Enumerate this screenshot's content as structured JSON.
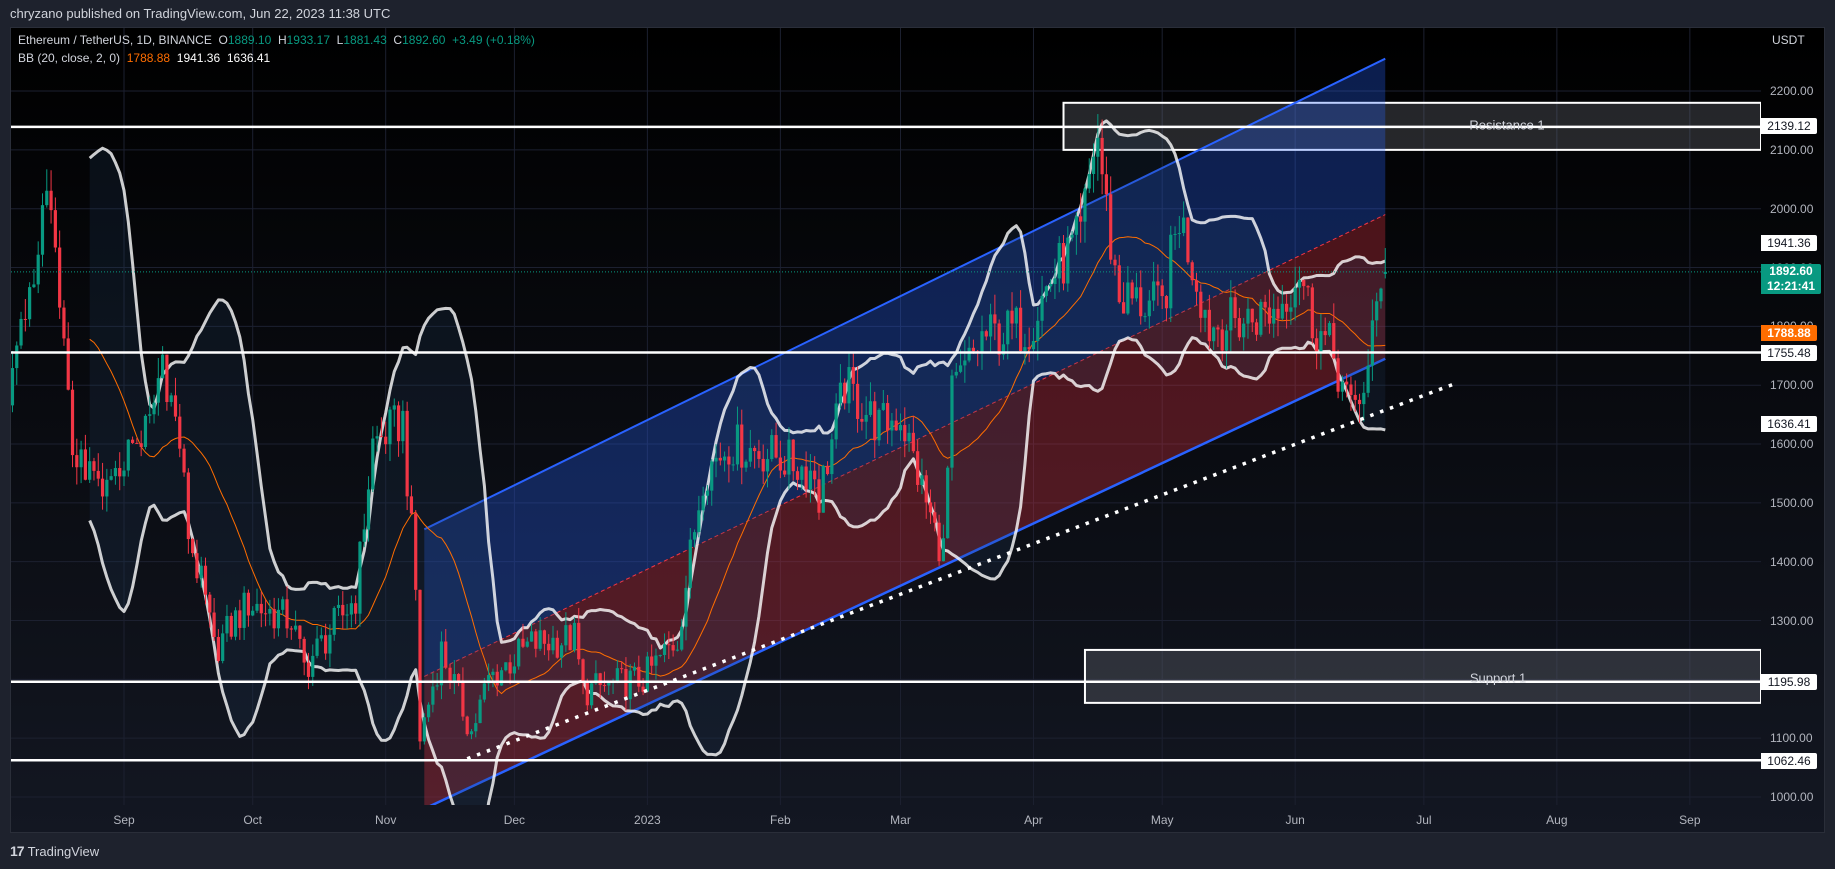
{
  "header": {
    "published": "chryzano published on TradingView.com, Jun 22, 2023 11:38 UTC"
  },
  "legend": {
    "symbol": "Ethereum / TetherUS, 1D, BINANCE",
    "o_label": "O",
    "o": "1889.10",
    "h_label": "H",
    "h": "1933.17",
    "l_label": "L",
    "l": "1881.43",
    "c_label": "C",
    "c": "1892.60",
    "change": "+3.49 (+0.18%)",
    "bb_label": "BB (20, close, 2, 0)",
    "bb_basis": "1788.88",
    "bb_upper": "1941.36",
    "bb_lower": "1636.41"
  },
  "axis": {
    "currency": "USDT",
    "price_ticks": [
      "2200.00",
      "2100.00",
      "2000.00",
      "1900.00",
      "1800.00",
      "1700.00",
      "1600.00",
      "1500.00",
      "1400.00",
      "1300.00",
      "1200.00",
      "1100.00",
      "1000.00"
    ],
    "month_ticks": [
      {
        "label": "Sep",
        "date": "2022-09-01"
      },
      {
        "label": "Oct",
        "date": "2022-10-01"
      },
      {
        "label": "Nov",
        "date": "2022-11-01"
      },
      {
        "label": "Dec",
        "date": "2022-12-01"
      },
      {
        "label": "2023",
        "date": "2023-01-01"
      },
      {
        "label": "Feb",
        "date": "2023-02-01"
      },
      {
        "label": "Mar",
        "date": "2023-03-01"
      },
      {
        "label": "Apr",
        "date": "2023-04-01"
      },
      {
        "label": "May",
        "date": "2023-05-01"
      },
      {
        "label": "Jun",
        "date": "2023-06-01"
      },
      {
        "label": "Jul",
        "date": "2023-07-01"
      },
      {
        "label": "Aug",
        "date": "2023-08-01"
      },
      {
        "label": "Sep",
        "date": "2023-09-01"
      }
    ]
  },
  "price_tags": {
    "resistance": "2139.12",
    "bb_upper": "1941.36",
    "last": "1892.60",
    "countdown": "12:21:41",
    "bb_basis": "1788.88",
    "level_mid": "1755.48",
    "bb_lower": "1636.41",
    "support": "1195.98",
    "level_low": "1062.46"
  },
  "zones": {
    "resistance_label": "Resistance 1",
    "support_label": "Support 1"
  },
  "footer": {
    "brand": "TradingView"
  },
  "colors": {
    "up": "#089981",
    "down": "#f23645",
    "basis": "#ff6d00",
    "channel": "#2962ff"
  },
  "chart_data": {
    "type": "candlestick",
    "title": "Ethereum / TetherUS, 1D, BINANCE",
    "ylabel": "USDT",
    "ylim": [
      960,
      2260
    ],
    "xlim": [
      "2022-08-05",
      "2023-09-20"
    ],
    "grid": true,
    "close_path": [
      [
        "2022-08-05",
        1700
      ],
      [
        "2022-08-13",
        1980
      ],
      [
        "2022-08-15",
        1990
      ],
      [
        "2022-08-20",
        1600
      ],
      [
        "2022-08-27",
        1500
      ],
      [
        "2022-09-01",
        1580
      ],
      [
        "2022-09-07",
        1630
      ],
      [
        "2022-09-10",
        1750
      ],
      [
        "2022-09-14",
        1600
      ],
      [
        "2022-09-16",
        1450
      ],
      [
        "2022-09-20",
        1330
      ],
      [
        "2022-09-22",
        1250
      ],
      [
        "2022-09-30",
        1330
      ],
      [
        "2022-10-10",
        1300
      ],
      [
        "2022-10-13",
        1220
      ],
      [
        "2022-10-20",
        1290
      ],
      [
        "2022-10-25",
        1340
      ],
      [
        "2022-10-29",
        1600
      ],
      [
        "2022-11-05",
        1640
      ],
      [
        "2022-11-08",
        1350
      ],
      [
        "2022-11-09",
        1100
      ],
      [
        "2022-11-14",
        1250
      ],
      [
        "2022-11-21",
        1110
      ],
      [
        "2022-11-25",
        1200
      ],
      [
        "2022-12-05",
        1260
      ],
      [
        "2022-12-15",
        1270
      ],
      [
        "2022-12-17",
        1180
      ],
      [
        "2022-12-31",
        1200
      ],
      [
        "2023-01-08",
        1270
      ],
      [
        "2023-01-14",
        1550
      ],
      [
        "2023-01-20",
        1600
      ],
      [
        "2023-01-31",
        1580
      ],
      [
        "2023-02-09",
        1550
      ],
      [
        "2023-02-10",
        1510
      ],
      [
        "2023-02-16",
        1700
      ],
      [
        "2023-02-24",
        1630
      ],
      [
        "2023-03-01",
        1650
      ],
      [
        "2023-03-09",
        1450
      ],
      [
        "2023-03-11",
        1420
      ],
      [
        "2023-03-13",
        1680
      ],
      [
        "2023-03-20",
        1780
      ],
      [
        "2023-03-31",
        1800
      ],
      [
        "2023-04-05",
        1880
      ],
      [
        "2023-04-12",
        1950
      ],
      [
        "2023-04-15",
        2100
      ],
      [
        "2023-04-16",
        2120
      ],
      [
        "2023-04-19",
        1940
      ],
      [
        "2023-04-21",
        1850
      ],
      [
        "2023-05-01",
        1830
      ],
      [
        "2023-05-05",
        1990
      ],
      [
        "2023-05-12",
        1800
      ],
      [
        "2023-05-20",
        1810
      ],
      [
        "2023-05-28",
        1830
      ],
      [
        "2023-06-02",
        1900
      ],
      [
        "2023-06-05",
        1810
      ],
      [
        "2023-06-10",
        1750
      ],
      [
        "2023-06-14",
        1650
      ],
      [
        "2023-06-18",
        1720
      ],
      [
        "2023-06-21",
        1890
      ],
      [
        "2023-06-22",
        1892.6
      ]
    ],
    "last_candle": {
      "date": "2023-06-22",
      "open": 1889.1,
      "high": 1933.17,
      "low": 1881.43,
      "close": 1892.6
    },
    "indicator": {
      "name": "BB",
      "length": 20,
      "mult": 2,
      "basis": 1788.88,
      "upper": 1941.36,
      "lower": 1636.41
    },
    "horizontal_levels": [
      2139.12,
      1755.48,
      1195.98,
      1062.46
    ],
    "zones": [
      {
        "label": "Resistance 1",
        "from": "2023-04-08",
        "top": 2180,
        "bottom": 2100
      },
      {
        "label": "Support 1",
        "from": "2023-04-13",
        "top": 1250,
        "bottom": 1160
      }
    ],
    "channel": {
      "from": "2022-11-10",
      "to": "2023-06-22",
      "upper": [
        1455,
        2255
      ],
      "middle": [
        1205,
        1990
      ],
      "lower": [
        980,
        1745
      ]
    },
    "trendline_dotted": {
      "from": [
        "2022-11-20",
        1065
      ],
      "to": [
        "2023-07-08",
        1702
      ]
    }
  }
}
